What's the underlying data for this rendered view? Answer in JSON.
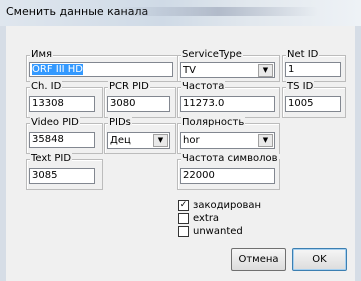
{
  "window": {
    "title": "Сменить данные канала"
  },
  "fields": {
    "name": {
      "label": "Имя",
      "value": "ORF III HD"
    },
    "service_type": {
      "label": "ServiceType",
      "value": "TV"
    },
    "net_id": {
      "label": "Net ID",
      "value": "1"
    },
    "ch_id": {
      "label": "Ch. ID",
      "value": "13308"
    },
    "pcr_pid": {
      "label": "PCR PID",
      "value": "3080"
    },
    "frequency": {
      "label": "Частота",
      "value": "11273.0"
    },
    "ts_id": {
      "label": "TS ID",
      "value": "1005"
    },
    "video_pid": {
      "label": "Video PID",
      "value": "35848"
    },
    "pids": {
      "label": "PIDs",
      "value": "Дец"
    },
    "polarity": {
      "label": "Полярность",
      "value": "hor"
    },
    "text_pid": {
      "label": "Text PID",
      "value": "3085"
    },
    "symbol_rate": {
      "label": "Частота символов",
      "value": "22000"
    }
  },
  "checkboxes": [
    {
      "label": "закодирован",
      "checked": true
    },
    {
      "label": "extra",
      "checked": false
    },
    {
      "label": "unwanted",
      "checked": false
    }
  ],
  "buttons": {
    "cancel": "Отмена",
    "ok": "OK"
  },
  "icons": {
    "combo_arrow": "dropdown-arrow-icon",
    "check": "checkmark-icon"
  }
}
